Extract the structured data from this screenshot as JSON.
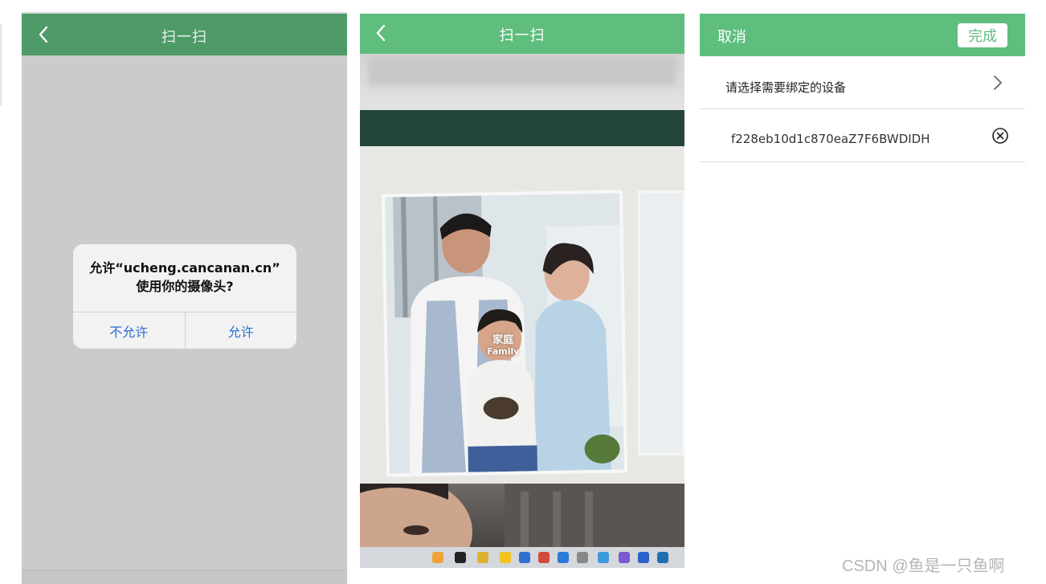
{
  "screen1": {
    "title": "扫一扫",
    "dialog": {
      "line1": "允许“ucheng.cancanan.cn”",
      "line2": "使用你的摄像头?",
      "deny_label": "不允许",
      "allow_label": "允许"
    }
  },
  "screen2": {
    "title": "扫一扫",
    "photo_label_zh": "家庭",
    "photo_label_en": "Family"
  },
  "screen3": {
    "cancel_label": "取消",
    "done_label": "完成",
    "select_label": "请选择需要绑定的设备",
    "device_id": "f228eb10d1c870eaZ7F6BWDIDH"
  },
  "watermark": "CSDN @鱼是一只鱼啊",
  "colors": {
    "header_green_dark": "#4f9a69",
    "header_green": "#5fbd7e",
    "dialog_button_blue": "#2a6fd4"
  },
  "icons": [
    "back-arrow-icon",
    "chevron-right-icon",
    "clear-circle-x-icon"
  ]
}
